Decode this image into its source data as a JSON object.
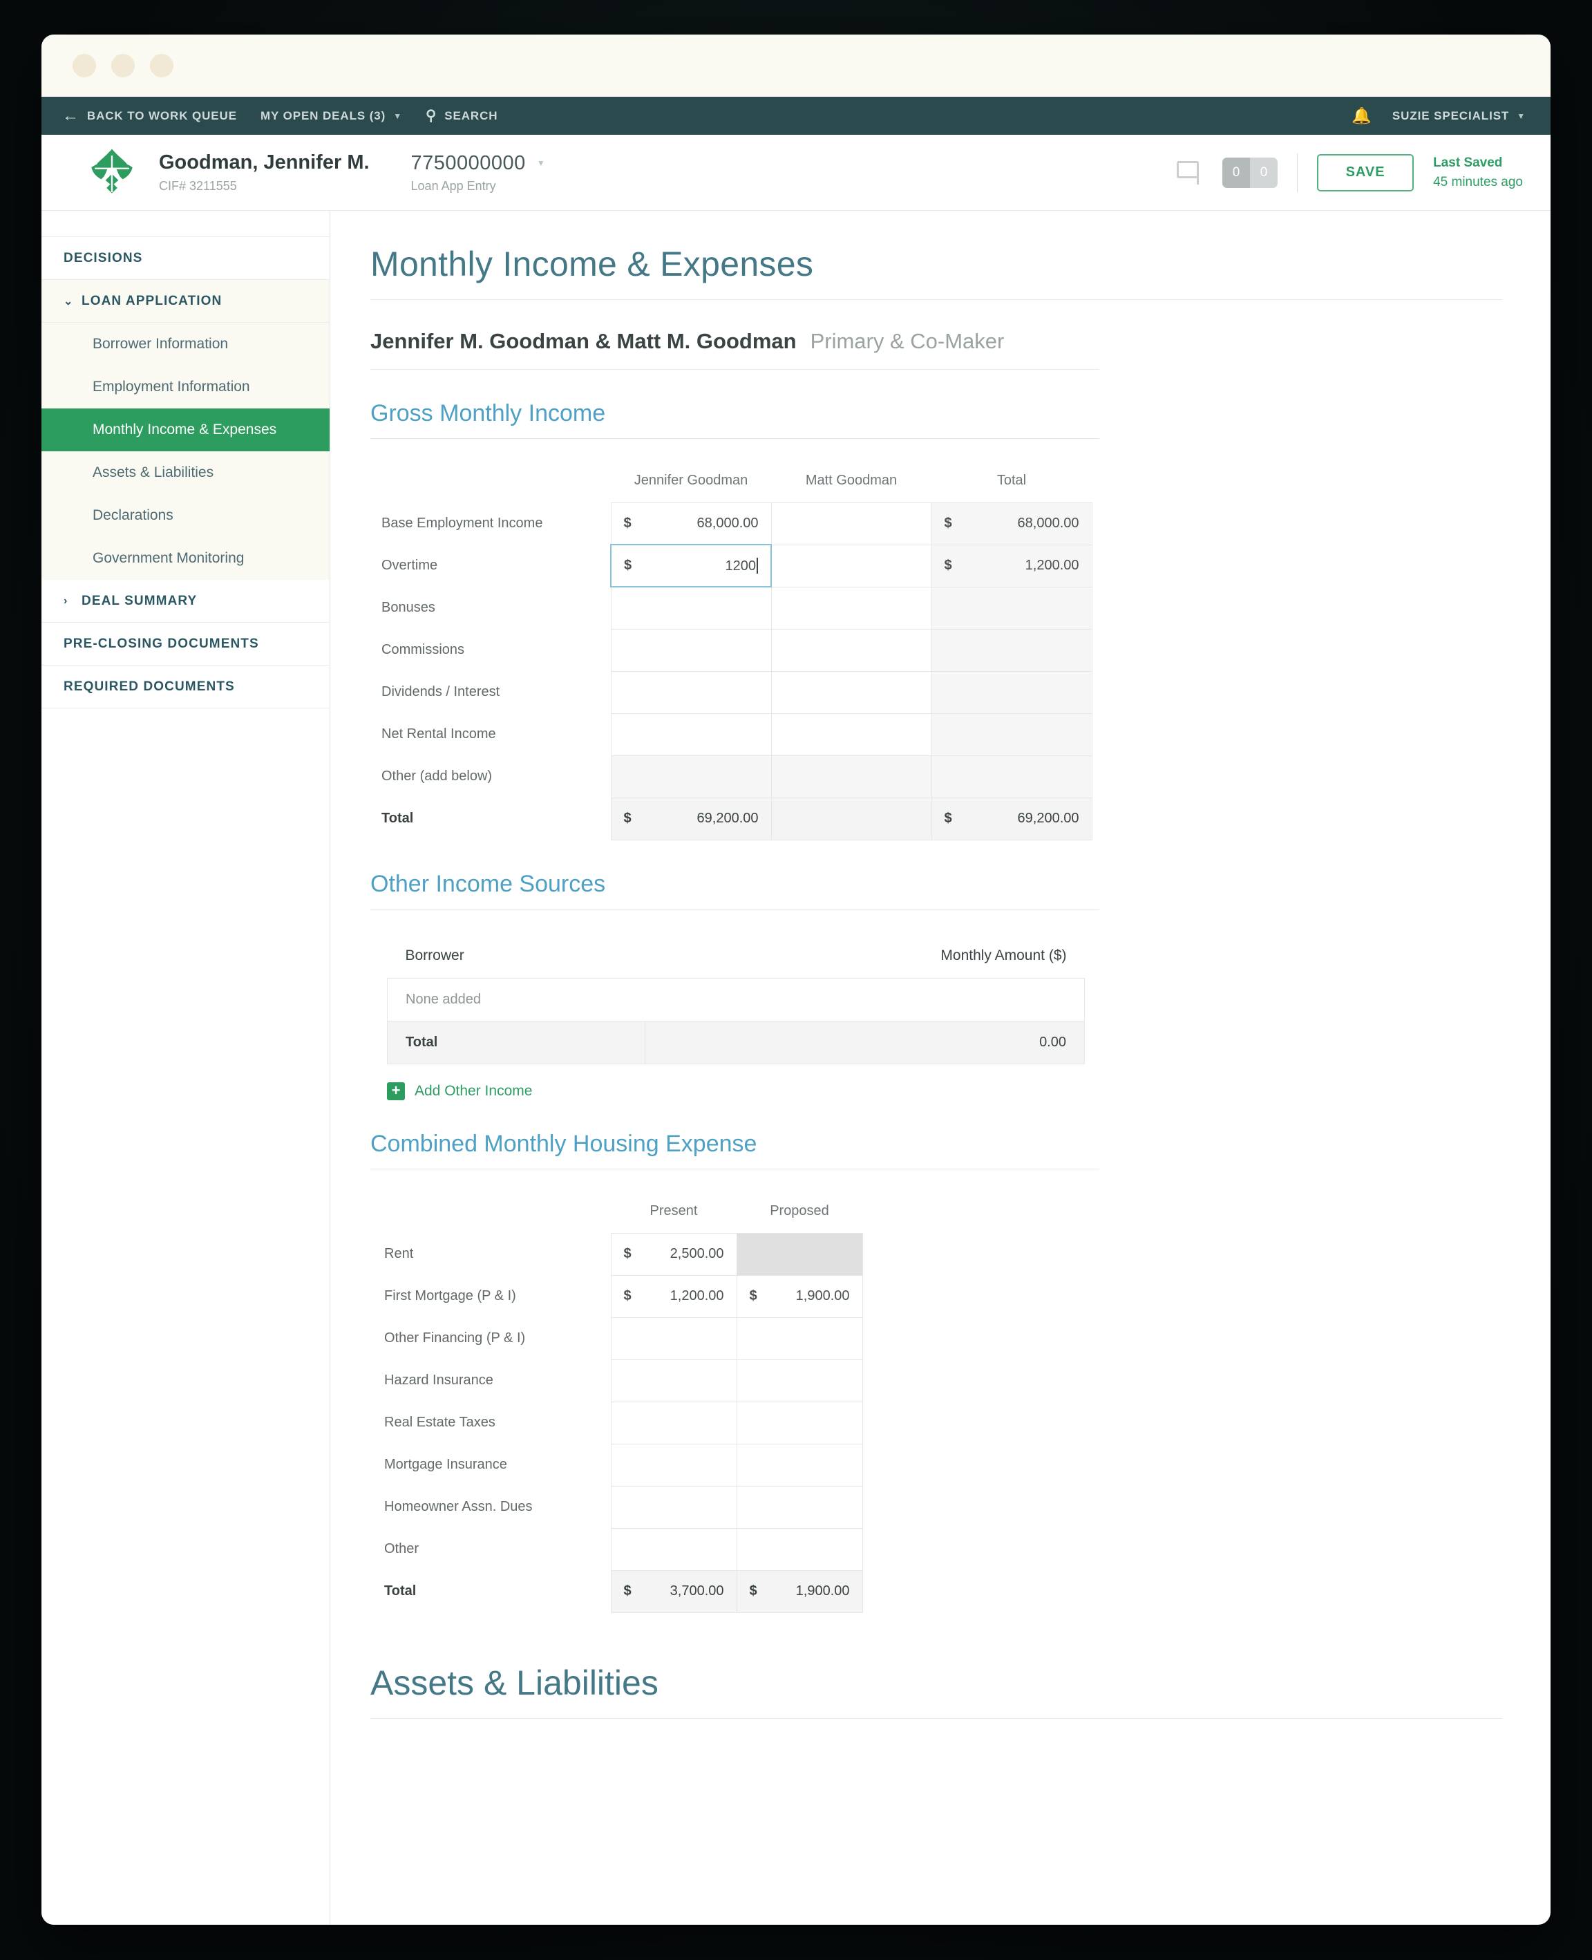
{
  "topnav": {
    "back_label": "BACK TO WORK QUEUE",
    "back_icon": "arrow-left-icon",
    "deals_label": "MY OPEN DEALS (3)",
    "deals_caret": "▼",
    "search_label": "SEARCH",
    "search_icon": "🔍",
    "bell_icon": "🔔",
    "user_label": "SUZIE SPECIALIST",
    "user_caret": "▼"
  },
  "dealbar": {
    "borrower_name": "Goodman, Jennifer M.",
    "cif": "CIF# 3211555",
    "loan_number": "7750000000",
    "loan_caret": "▼",
    "loan_stage": "Loan App Entry",
    "comment_count_1": "0",
    "comment_count_2": "0",
    "save_label": "SAVE",
    "last_saved_label": "Last Saved",
    "last_saved_time": "45 minutes ago"
  },
  "sidebar": {
    "decisions": "DECISIONS",
    "loan_application": "LOAN APPLICATION",
    "loan_app_chevron": "⌄",
    "items": [
      {
        "label": "Borrower Information"
      },
      {
        "label": "Employment Information"
      },
      {
        "label": "Monthly Income & Expenses"
      },
      {
        "label": "Assets & Liabilities"
      },
      {
        "label": "Declarations"
      },
      {
        "label": "Government Monitoring"
      }
    ],
    "deal_summary": "DEAL SUMMARY",
    "deal_summary_chevron": "›",
    "pre_closing": "PRE-CLOSING DOCUMENTS",
    "required_docs": "REQUIRED DOCUMENTS"
  },
  "main": {
    "page_title": "Monthly Income & Expenses",
    "applicants": "Jennifer M. Goodman & Matt M. Goodman",
    "applicants_roles": "Primary & Co-Maker",
    "bottom_title": "Assets & Liabilities",
    "gross_income": {
      "title": "Gross Monthly Income",
      "columns": [
        "Jennifer Goodman",
        "Matt Goodman",
        "Total"
      ],
      "rows": [
        {
          "label": "Base Employment Income",
          "jennifer": "68,000.00",
          "matt": "",
          "total": "68,000.00"
        },
        {
          "label": "Overtime",
          "jennifer": "1200",
          "matt": "",
          "total": "1,200.00"
        },
        {
          "label": "Bonuses",
          "jennifer": "",
          "matt": "",
          "total": ""
        },
        {
          "label": "Commissions",
          "jennifer": "",
          "matt": "",
          "total": ""
        },
        {
          "label": "Dividends / Interest",
          "jennifer": "",
          "matt": "",
          "total": ""
        },
        {
          "label": "Net Rental Income",
          "jennifer": "",
          "matt": "",
          "total": ""
        },
        {
          "label": "Other (add below)",
          "jennifer": "",
          "matt": "",
          "total": ""
        }
      ],
      "total_row": {
        "label": "Total",
        "jennifer": "69,200.00",
        "matt": "",
        "total": "69,200.00"
      },
      "currency_symbol": "$"
    },
    "other_income": {
      "title": "Other Income Sources",
      "col_borrower": "Borrower",
      "col_amount": "Monthly Amount ($)",
      "empty_text": "None added",
      "total_label": "Total",
      "total_value": "0.00",
      "add_link": "Add Other Income",
      "add_icon": "plus-icon"
    },
    "housing": {
      "title": "Combined Monthly Housing Expense",
      "columns": [
        "Present",
        "Proposed"
      ],
      "rows": [
        {
          "label": "Rent",
          "present": "2,500.00",
          "proposed": "",
          "proposed_disabled": true
        },
        {
          "label": "First Mortgage (P & I)",
          "present": "1,200.00",
          "proposed": "1,900.00"
        },
        {
          "label": "Other Financing (P & I)",
          "present": "",
          "proposed": ""
        },
        {
          "label": "Hazard Insurance",
          "present": "",
          "proposed": ""
        },
        {
          "label": "Real Estate Taxes",
          "present": "",
          "proposed": ""
        },
        {
          "label": "Mortgage Insurance",
          "present": "",
          "proposed": ""
        },
        {
          "label": "Homeowner Assn. Dues",
          "present": "",
          "proposed": ""
        },
        {
          "label": "Other",
          "present": "",
          "proposed": ""
        }
      ],
      "total_row": {
        "label": "Total",
        "present": "3,700.00",
        "proposed": "1,900.00"
      },
      "currency_symbol": "$"
    }
  },
  "colors": {
    "nav_bg": "#2b4a4e",
    "accent_green": "#2d9c5f",
    "heading_blue": "#447887",
    "section_blue": "#4ea0c4",
    "focus_blue": "#86c3dd"
  }
}
